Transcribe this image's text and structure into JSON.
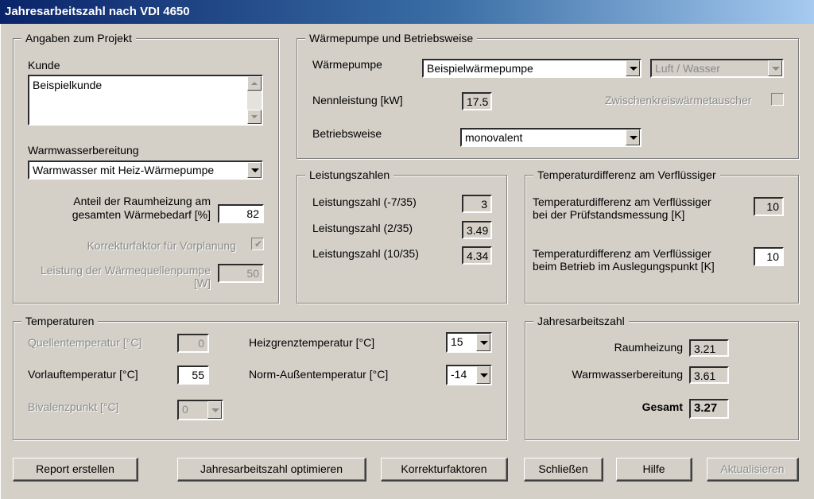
{
  "window": {
    "title": "Jahresarbeitszahl nach VDI 4650"
  },
  "projekt": {
    "legend": "Angaben zum Projekt",
    "kunde_label": "Kunde",
    "kunde_value": "Beispielkunde",
    "warmwasser_label": "Warmwasserbereitung",
    "warmwasser_value": "Warmwasser mit Heiz-Wärmepumpe",
    "anteil_label_1": "Anteil der Raumheizung am",
    "anteil_label_2": "gesamten Wärmebedarf [%]",
    "anteil_value": "82",
    "korrektur_label": "Korrekturfaktor für Vorplanung",
    "korrektur_checked": true,
    "leistung_label_1": "Leistung der Wärmequellenpumpe",
    "leistung_label_2": "[W]",
    "leistung_value": "50"
  },
  "waermepumpe": {
    "legend": "Wärmepumpe und Betriebsweise",
    "wp_label": "Wärmepumpe",
    "wp_value": "Beispielwärmepumpe",
    "typ_value": "Luft / Wasser",
    "nenn_label": "Nennleistung [kW]",
    "nenn_value": "17.5",
    "zwischen_label": "Zwischenkreiswärmetauscher",
    "zwischen_checked": false,
    "betrieb_label": "Betriebsweise",
    "betrieb_value": "monovalent"
  },
  "leistungszahlen": {
    "legend": "Leistungszahlen",
    "rows": [
      {
        "label": "Leistungszahl (-7/35)",
        "value": "3"
      },
      {
        "label": "Leistungszahl (2/35)",
        "value": "3.49"
      },
      {
        "label": "Leistungszahl (10/35)",
        "value": "4.34"
      }
    ]
  },
  "tempdiff": {
    "legend": "Temperaturdifferenz am Verflüssiger",
    "pruef_label_1": "Temperaturdifferenz am Verflüssiger",
    "pruef_label_2": "bei der Prüfstandsmessung [K]",
    "pruef_value": "10",
    "betrieb_label_1": "Temperaturdifferenz am Verflüssiger",
    "betrieb_label_2": "beim Betrieb im Auslegungspunkt [K]",
    "betrieb_value": "10"
  },
  "temperaturen": {
    "legend": "Temperaturen",
    "quelle_label": "Quellentemperatur [°C]",
    "quelle_value": "0",
    "vorlauf_label": "Vorlauftemperatur [°C]",
    "vorlauf_value": "55",
    "bival_label": "Bivalenzpunkt [°C]",
    "bival_value": "0",
    "heizgrenz_label": "Heizgrenztemperatur [°C]",
    "heizgrenz_value": "15",
    "norm_label": "Norm-Außentemperatur [°C]",
    "norm_value": "-14"
  },
  "jaz": {
    "legend": "Jahresarbeitszahl",
    "raum_label": "Raumheizung",
    "raum_value": "3.21",
    "ww_label": "Warmwasserbereitung",
    "ww_value": "3.61",
    "gesamt_label": "Gesamt",
    "gesamt_value": "3.27"
  },
  "buttons": {
    "report": "Report erstellen",
    "optimieren": "Jahresarbeitszahl optimieren",
    "korrektur": "Korrekturfaktoren",
    "schliessen": "Schließen",
    "hilfe": "Hilfe",
    "aktualisieren": "Aktualisieren"
  },
  "colors": {
    "title_bar": "#0a246a",
    "face": "#d4d0c8",
    "disabled_text": "#8a8a8a"
  }
}
